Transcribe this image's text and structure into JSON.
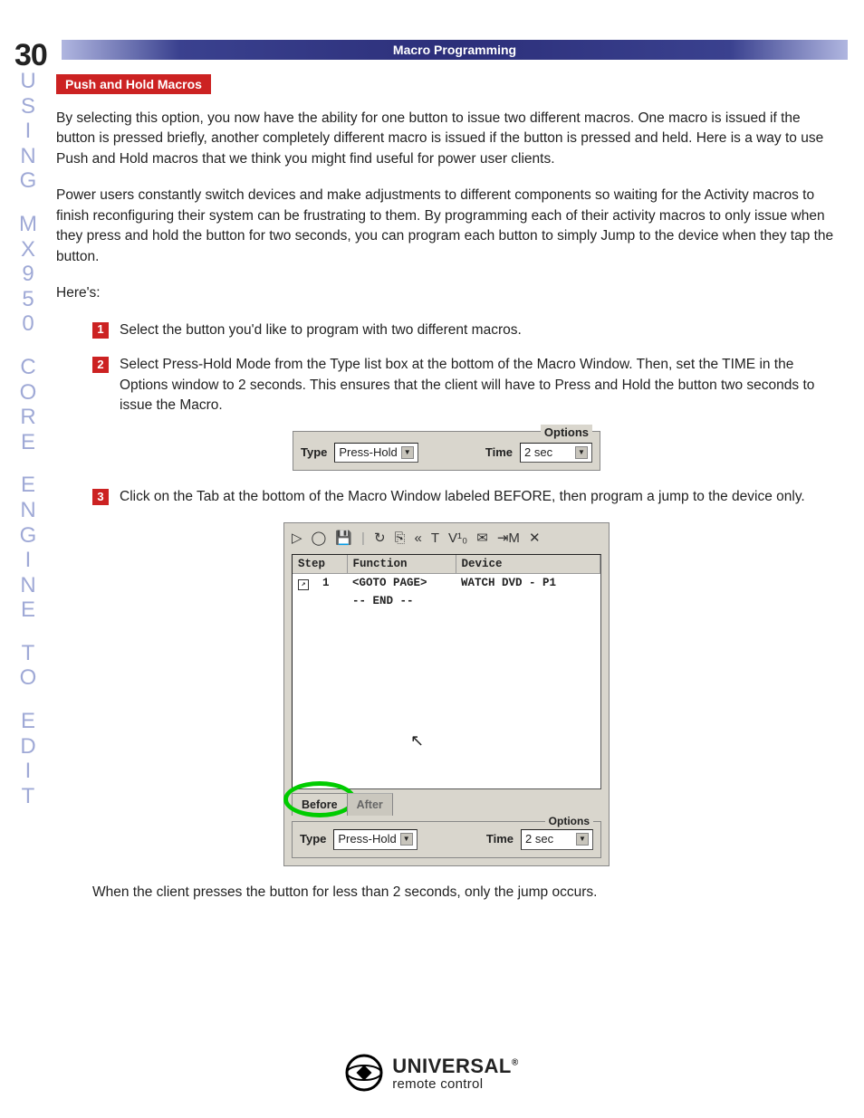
{
  "page_number": "30",
  "side_text": [
    "U",
    "S",
    "I",
    "N",
    "G",
    "",
    "M",
    "X",
    "9",
    "5",
    "0",
    "",
    "C",
    "O",
    "R",
    "E",
    "",
    "E",
    "N",
    "G",
    "I",
    "N",
    "E",
    "",
    "T",
    "O",
    "",
    "E",
    "D",
    "I",
    "T"
  ],
  "header_band": "Macro Programming",
  "subheader": "Push and Hold Macros",
  "para1": "By selecting this option, you now have the ability for one button to issue two different macros. One macro is issued if the button is pressed briefly, another completely different macro is issued if the button is pressed and held. Here is a way to use Push and Hold macros that we think you might find useful for power user clients.",
  "para2": "Power users constantly switch devices and make adjustments to different components so waiting for the Activity macros to finish reconfiguring their system can be frustrating to them. By programming each of their activity macros to only issue when they press and hold the button for two seconds, you can program each button to simply Jump to the device when they tap the button.",
  "heres": "Here's:",
  "step1": "Select the button you'd like to program with two different macros.",
  "step2": "Select Press-Hold Mode from the Type list box at the bottom of the Macro Window. Then, set the TIME in the Options window to 2 seconds. This ensures that the client will have to Press and Hold the button two seconds to issue the Macro.",
  "step3": "Click on the Tab at the bottom of the Macro Window labeled BEFORE, then program a jump to the device only.",
  "fig1": {
    "options_label": "Options",
    "type_label": "Type",
    "type_value": "Press-Hold",
    "time_label": "Time",
    "time_value": "2 sec"
  },
  "fig2": {
    "toolbar": [
      "▷",
      "◯",
      "💾",
      "|",
      "↻",
      "⎘",
      "«",
      "T",
      "V¹₀",
      "✉",
      "⇥M",
      "✕"
    ],
    "headers": {
      "step": "Step",
      "function": "Function",
      "device": "Device"
    },
    "row": {
      "num": "1",
      "function": "<GOTO PAGE>",
      "device": "WATCH DVD - P1"
    },
    "end": "-- END --",
    "tab_before": "Before",
    "tab_after": "After",
    "options_label": "Options",
    "type_label": "Type",
    "type_value": "Press-Hold",
    "time_label": "Time",
    "time_value": "2 sec"
  },
  "footer_text": "When the client presses the button for less than 2 seconds, only the jump occurs.",
  "logo": {
    "brand": "UNIVERSAL",
    "reg": "®",
    "sub": "remote control"
  }
}
